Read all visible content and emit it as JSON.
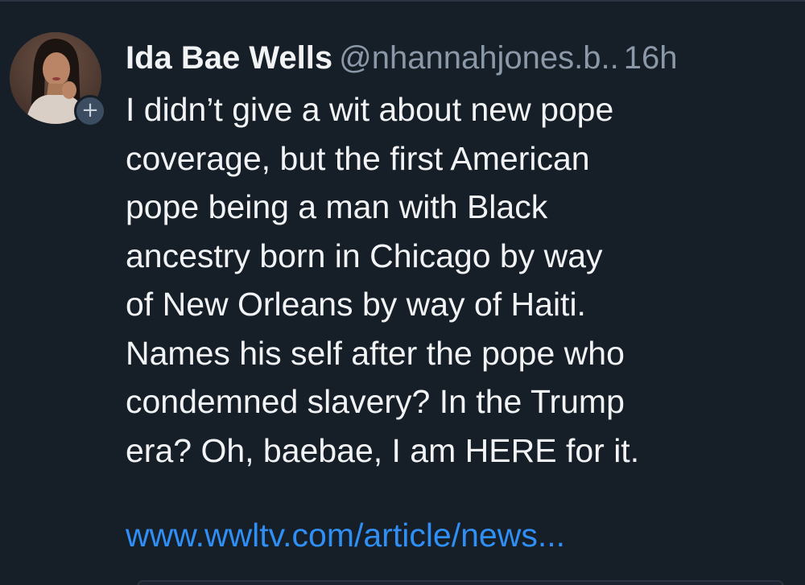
{
  "post": {
    "author": {
      "display_name": "Ida Bae Wells",
      "handle": "@nhannahjones.b..",
      "avatar_icon": "profile-photo",
      "follow_badge": "+"
    },
    "timestamp": "16h",
    "text_lines": [
      "I didn’t give a wit about new pope",
      "coverage, but the first American",
      "pope being a man with Black",
      "ancestry born in Chicago by way",
      "of New Orleans by way of Haiti.",
      "Names his self after the pope who",
      "condemned slavery? In the Trump",
      "era? Oh, baebae, I am HERE for it."
    ],
    "link_text": "www.wwltv.com/article/news..."
  },
  "colors": {
    "background": "#161e27",
    "text_primary": "#f1f3f5",
    "text_secondary": "#8b98a7",
    "link": "#2f8ff5"
  }
}
